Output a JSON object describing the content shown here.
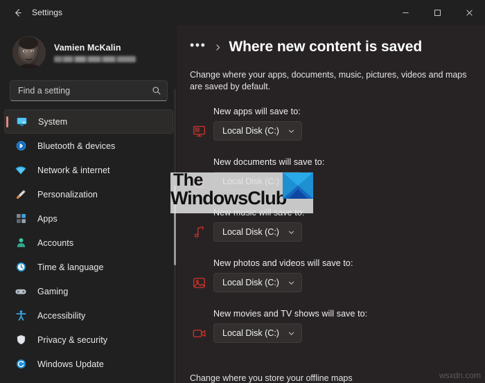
{
  "window": {
    "title": "Settings",
    "back_icon": "arrow-left-icon",
    "controls": {
      "minimize": "—",
      "maximize": "□",
      "close": "✕"
    },
    "accent_color": "#e08a7e"
  },
  "account": {
    "name": "Vamien McKalin",
    "email_redacted": true,
    "avatar_alt": "user-avatar"
  },
  "search": {
    "placeholder": "Find a setting",
    "icon": "search-icon"
  },
  "sidebar": {
    "items": [
      {
        "label": "System",
        "icon": "monitor-icon",
        "selected": true
      },
      {
        "label": "Bluetooth & devices",
        "icon": "bluetooth-icon",
        "selected": false
      },
      {
        "label": "Network & internet",
        "icon": "wifi-icon",
        "selected": false
      },
      {
        "label": "Personalization",
        "icon": "paintbrush-icon",
        "selected": false
      },
      {
        "label": "Apps",
        "icon": "apps-grid-icon",
        "selected": false
      },
      {
        "label": "Accounts",
        "icon": "person-icon",
        "selected": false
      },
      {
        "label": "Time & language",
        "icon": "clock-icon",
        "selected": false
      },
      {
        "label": "Gaming",
        "icon": "gamepad-icon",
        "selected": false
      },
      {
        "label": "Accessibility",
        "icon": "accessibility-icon",
        "selected": false
      },
      {
        "label": "Privacy & security",
        "icon": "shield-icon",
        "selected": false
      },
      {
        "label": "Windows Update",
        "icon": "refresh-icon",
        "selected": false
      }
    ]
  },
  "main": {
    "breadcrumb_overflow": "•••",
    "breadcrumb_separator": "chevron-right-icon",
    "title": "Where new content is saved",
    "description": "Change where your apps, documents, music, pictures, videos and maps are saved by default.",
    "groups": [
      {
        "label": "New apps will save to:",
        "icon": "app-monitor-icon",
        "value": "Local Disk (C:)"
      },
      {
        "label": "New documents will save to:",
        "icon": "document-icon",
        "value": "Local Disk (C:)"
      },
      {
        "label": "New music will save to:",
        "icon": "music-note-icon",
        "value": "Local Disk (C:)"
      },
      {
        "label": "New photos and videos will save to:",
        "icon": "photo-icon",
        "value": "Local Disk (C:)"
      },
      {
        "label": "New movies and TV shows will save to:",
        "icon": "video-camera-icon",
        "value": "Local Disk (C:)"
      }
    ],
    "footer_text": "Change where you store your offline maps"
  },
  "watermarks": {
    "overlay_line1": "The",
    "overlay_line2": "WindowsClub",
    "site": "wsxdn.com"
  }
}
